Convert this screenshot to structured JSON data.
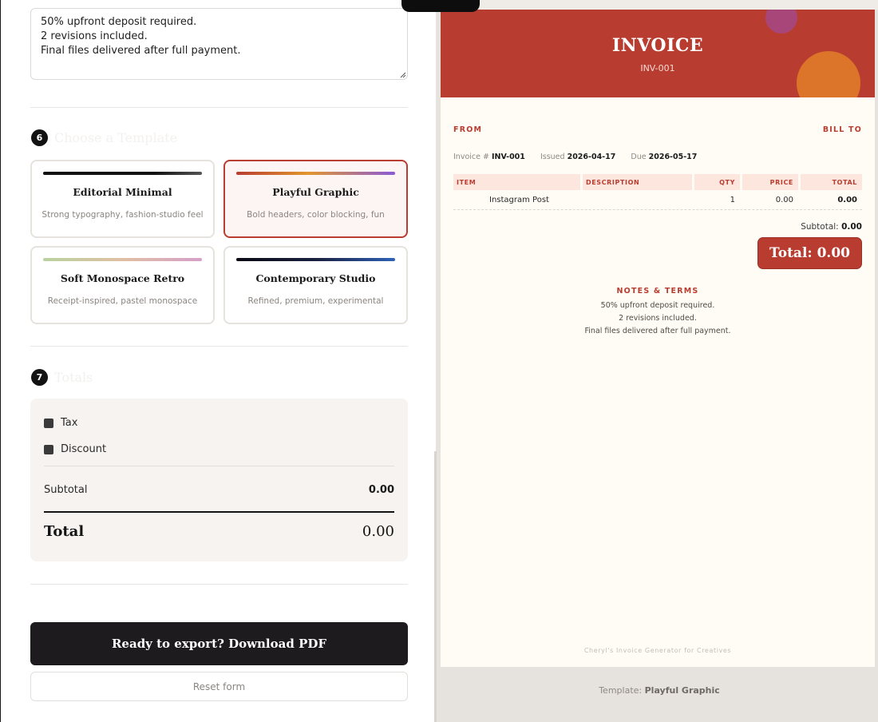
{
  "notes": {
    "value": "50% upfront deposit required.\n2 revisions included.\nFinal files delivered after full payment."
  },
  "step6": {
    "number": "6",
    "title": "Choose a Template"
  },
  "templates": [
    {
      "name": "Editorial Minimal",
      "desc": "Strong typography, fashion-studio feel",
      "selected": false
    },
    {
      "name": "Playful Graphic",
      "desc": "Bold headers, color blocking, fun",
      "selected": true
    },
    {
      "name": "Soft Monospace Retro",
      "desc": "Receipt-inspired, pastel monospace",
      "selected": false
    },
    {
      "name": "Contemporary Studio",
      "desc": "Refined, premium, experimental",
      "selected": false
    }
  ],
  "step7": {
    "number": "7",
    "title": "Totals"
  },
  "totals": {
    "tax_label": "Tax",
    "discount_label": "Discount",
    "subtotal_label": "Subtotal",
    "subtotal_value": "0.00",
    "total_label": "Total",
    "total_value": "0.00"
  },
  "actions": {
    "export_label": "Ready to export? Download PDF",
    "reset_label": "Reset form"
  },
  "preview": {
    "title": "INVOICE",
    "number": "INV-001",
    "from_label": "FROM",
    "bill_to_label": "BILL TO",
    "meta": {
      "invoice_label": "Invoice #",
      "invoice_value": "INV-001",
      "issued_label": "Issued",
      "issued_value": "2026-04-17",
      "due_label": "Due",
      "due_value": "2026-05-17"
    },
    "table": {
      "headers": [
        "ITEM",
        "DESCRIPTION",
        "QTY",
        "PRICE",
        "TOTAL"
      ],
      "rows": [
        {
          "item": "Instagram Post",
          "description": "",
          "qty": "1",
          "price": "0.00",
          "total": "0.00"
        }
      ]
    },
    "subtotal_label": "Subtotal:",
    "subtotal_value": "0.00",
    "total_text": "Total: 0.00",
    "notes_title": "NOTES & TERMS",
    "notes_lines": [
      "50% upfront deposit required.",
      "2 revisions included.",
      "Final files delivered after full payment."
    ],
    "footer": "Cheryl's Invoice Generator for Creatives"
  },
  "template_caption": {
    "prefix": "Template:",
    "name": "Playful Graphic"
  },
  "colors": {
    "brand_red": "#b83d30",
    "dark": "#1d1b1d",
    "accent_orange": "#e07a2a",
    "accent_magenta": "#a8467a"
  }
}
